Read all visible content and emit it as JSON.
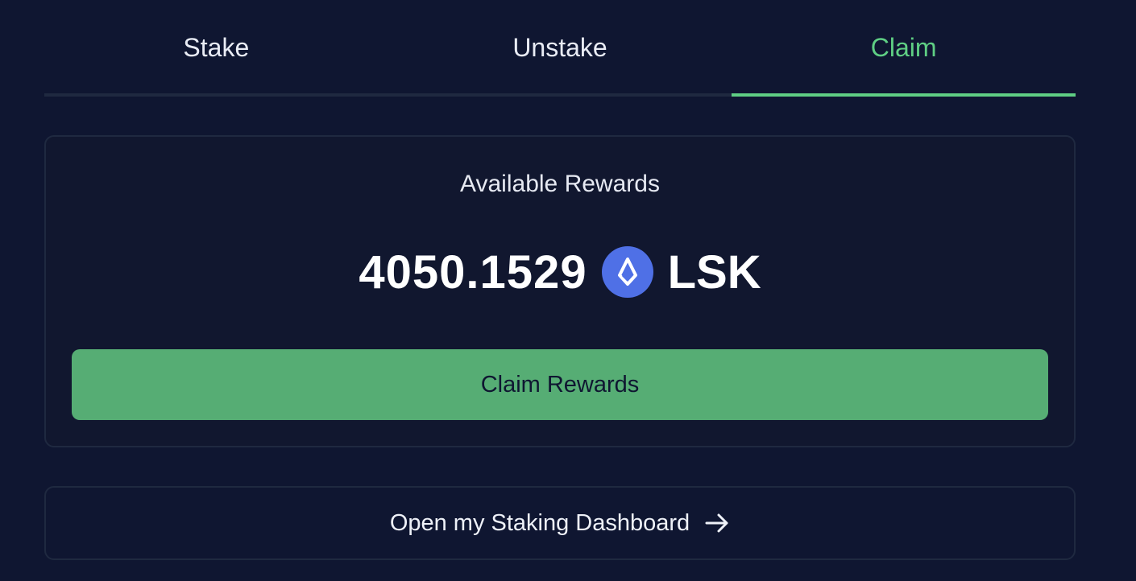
{
  "tabs": [
    {
      "label": "Stake",
      "active": false
    },
    {
      "label": "Unstake",
      "active": false
    },
    {
      "label": "Claim",
      "active": true
    }
  ],
  "rewards": {
    "title": "Available Rewards",
    "amount": "4050.1529",
    "token_icon": "lisk-token-icon",
    "token_symbol": "LSK",
    "claim_button_label": "Claim Rewards"
  },
  "dashboard_link": {
    "label": "Open my Staking Dashboard",
    "icon": "arrow-right-icon"
  },
  "colors": {
    "background": "#0f1631",
    "accent": "#5fcf84",
    "button": "#56ad74",
    "token": "#4f70e6"
  }
}
